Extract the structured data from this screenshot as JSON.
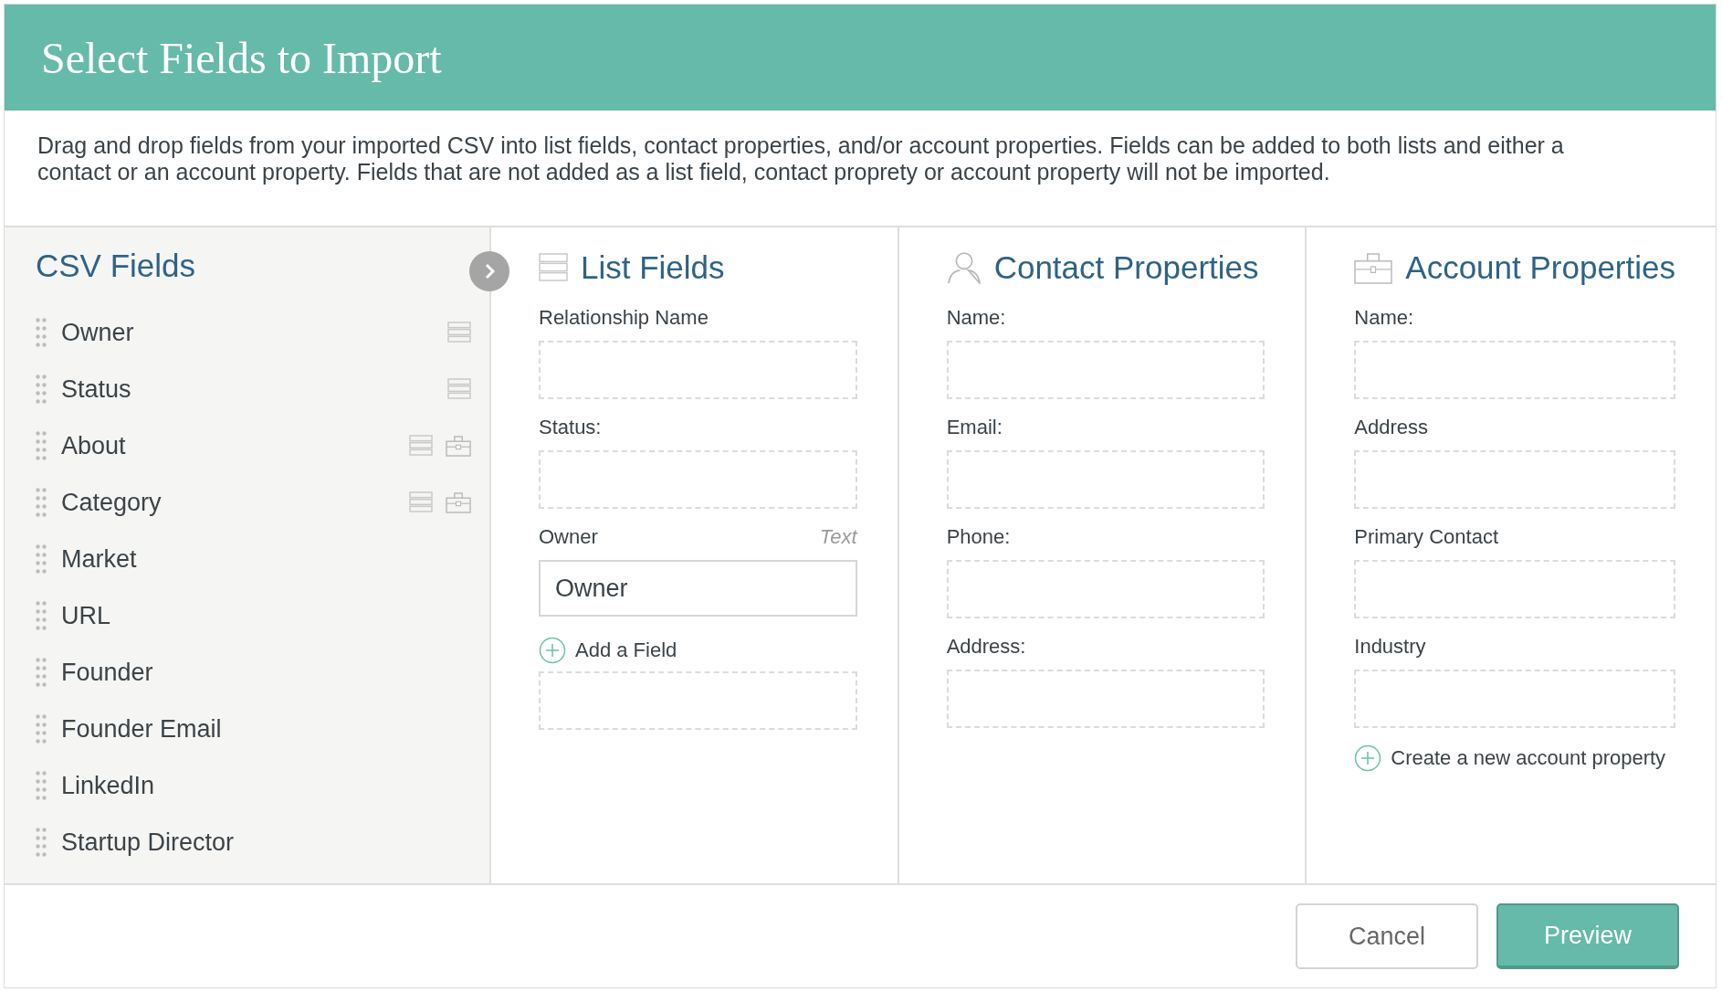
{
  "dialog": {
    "title": "Select Fields to Import",
    "description": "Drag and drop fields from your imported CSV into list fields, contact properties, and/or account properties. Fields can be added to both lists and either a contact or an account property. Fields that are not added as a list field, contact proprety or account property will not be imported."
  },
  "csv_fields": {
    "title": "CSV Fields",
    "items": [
      {
        "label": "Owner",
        "list_field": true,
        "account_property": false
      },
      {
        "label": "Status",
        "list_field": true,
        "account_property": false
      },
      {
        "label": "About",
        "list_field": true,
        "account_property": true
      },
      {
        "label": "Category",
        "list_field": true,
        "account_property": true
      },
      {
        "label": "Market",
        "list_field": false,
        "account_property": false
      },
      {
        "label": "URL",
        "list_field": false,
        "account_property": false
      },
      {
        "label": "Founder",
        "list_field": false,
        "account_property": false
      },
      {
        "label": "Founder Email",
        "list_field": false,
        "account_property": false
      },
      {
        "label": "LinkedIn",
        "list_field": false,
        "account_property": false
      },
      {
        "label": "Startup Director",
        "list_field": false,
        "account_property": false
      }
    ]
  },
  "columns": [
    {
      "kind": "list",
      "title": "List Fields",
      "items": [
        {
          "kind": "field",
          "label": "Relationship Name"
        },
        {
          "kind": "field",
          "label": "Status:"
        },
        {
          "kind": "field",
          "label": "Owner",
          "hint": "Text",
          "value": "Owner"
        },
        {
          "kind": "add",
          "label": "Add a Field"
        },
        {
          "kind": "dropzone"
        }
      ]
    },
    {
      "kind": "contact",
      "title": "Contact Properties",
      "items": [
        {
          "kind": "field",
          "label": "Name:"
        },
        {
          "kind": "field",
          "label": "Email:"
        },
        {
          "kind": "field",
          "label": "Phone:"
        },
        {
          "kind": "field",
          "label": "Address:"
        }
      ]
    },
    {
      "kind": "account",
      "title": "Account Properties",
      "items": [
        {
          "kind": "field",
          "label": "Name:"
        },
        {
          "kind": "field",
          "label": "Address"
        },
        {
          "kind": "field",
          "label": "Primary Contact"
        },
        {
          "kind": "field",
          "label": "Industry"
        },
        {
          "kind": "add",
          "label": "Create a new account property"
        }
      ]
    }
  ],
  "buttons": [
    {
      "label": "Cancel",
      "kind": "secondary"
    },
    {
      "label": "Preview",
      "kind": "primary"
    }
  ]
}
